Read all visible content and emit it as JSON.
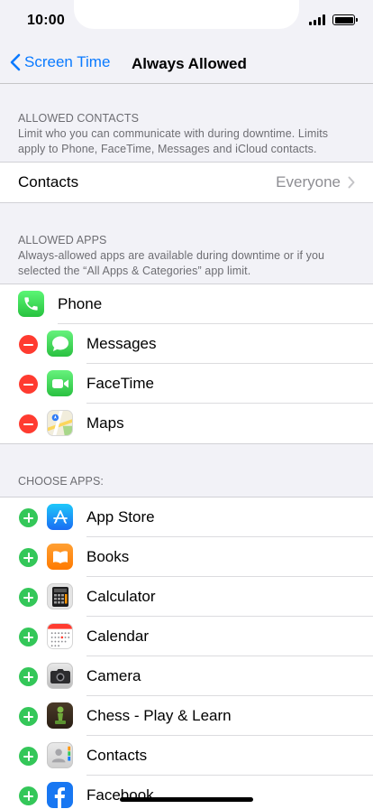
{
  "status": {
    "time": "10:00"
  },
  "nav": {
    "back_label": "Screen Time",
    "title": "Always Allowed"
  },
  "contacts_section": {
    "title": "ALLOWED CONTACTS",
    "description": "Limit who you can communicate with during downtime. Limits apply to Phone, FaceTime, Messages and iCloud contacts.",
    "row_label": "Contacts",
    "row_value": "Everyone"
  },
  "allowed_section": {
    "title": "ALLOWED APPS",
    "description": "Always-allowed apps are available during downtime or if you selected the “All Apps & Categories” app limit.",
    "apps": [
      {
        "label": "Phone",
        "icon": "phone-icon"
      },
      {
        "label": "Messages",
        "icon": "messages-icon"
      },
      {
        "label": "FaceTime",
        "icon": "facetime-icon"
      },
      {
        "label": "Maps",
        "icon": "maps-icon"
      }
    ]
  },
  "choose_section": {
    "title": "CHOOSE APPS:",
    "apps": [
      {
        "label": "App Store",
        "icon": "app-store-icon"
      },
      {
        "label": "Books",
        "icon": "books-icon"
      },
      {
        "label": "Calculator",
        "icon": "calculator-icon"
      },
      {
        "label": "Calendar",
        "icon": "calendar-icon"
      },
      {
        "label": "Camera",
        "icon": "camera-icon"
      },
      {
        "label": "Chess - Play & Learn",
        "icon": "chess-icon"
      },
      {
        "label": "Contacts",
        "icon": "contacts-icon"
      },
      {
        "label": "Facebook",
        "icon": "facebook-icon"
      }
    ]
  },
  "colors": {
    "accent": "#0a7aff",
    "remove": "#ff3b30",
    "add": "#34c759",
    "background": "#f2f2f7"
  }
}
